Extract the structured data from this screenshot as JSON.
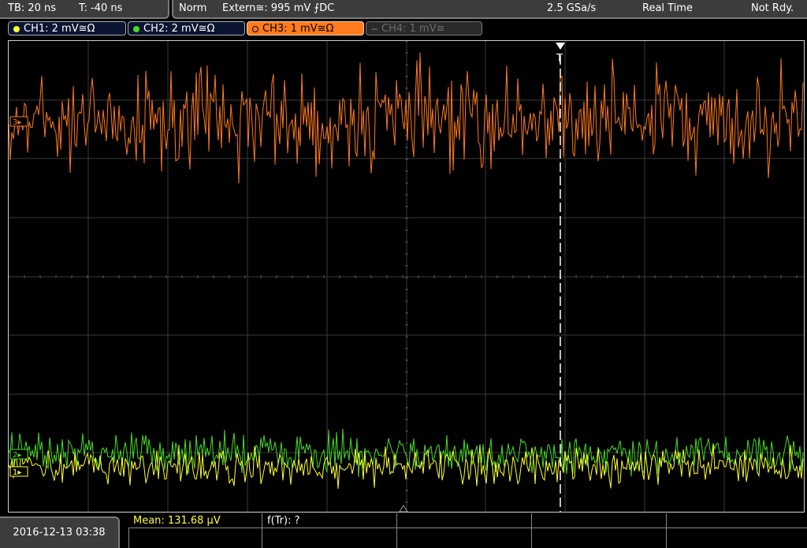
{
  "status_left": {
    "timebase": "TB: 20 ns",
    "trigger_offset": "T: -40 ns"
  },
  "status_right": {
    "mode": "Norm",
    "trigger": "Extern≅: 995 mV ⨍DC",
    "sample_rate": "2.5 GSa/s",
    "acq_mode": "Real Time",
    "state": "Not Rdy."
  },
  "channels": [
    {
      "label": "CH1: 2 mV≅Ω",
      "color": "#ffff30",
      "active": true
    },
    {
      "label": "CH2: 2 mV≅Ω",
      "color": "#44dd22",
      "active": true
    },
    {
      "label": "CH3: 1 mV≅Ω",
      "color": "#ff7a1c",
      "active": true,
      "selected": true
    },
    {
      "label": "CH4: 1 mV≅",
      "color": "#666666",
      "active": false
    }
  ],
  "markers": {
    "trigger_marker": "T",
    "ch3_marker": "3▸",
    "ch2_marker": "2▸",
    "ch1_marker": "1▸"
  },
  "footer": {
    "datetime": "2016-12-13 03:38",
    "measurement_mean": "Mean: 131.68 µV",
    "measurement_ftr": "f(Tr): ?"
  }
}
